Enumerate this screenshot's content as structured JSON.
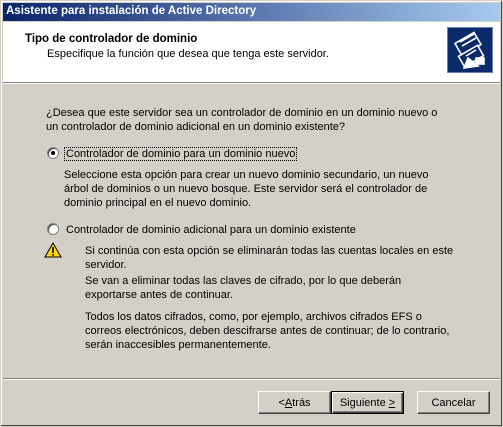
{
  "window": {
    "title": "Asistente para instalación de Active Directory"
  },
  "header": {
    "title": "Tipo de controlador de dominio",
    "subtitle": "Especifique la función que desea que tenga este servidor.",
    "icon": "active-directory-wizard-icon"
  },
  "main": {
    "question": "¿Desea que este servidor sea un controlador de dominio en un dominio nuevo o un controlador de dominio adicional en un dominio existente?",
    "options": [
      {
        "label": "Controlador de dominio para un dominio nuevo",
        "selected": true,
        "description": "Seleccione esta opción para crear un nuevo dominio secundario, un nuevo árbol de dominios o un nuevo bosque. Este servidor será el controlador de dominio principal en el nuevo dominio."
      },
      {
        "label": "Controlador de dominio adicional para un dominio existente",
        "selected": false
      }
    ],
    "warning": {
      "icon": "warning-icon",
      "line1": "Si continúa con esta opción se eliminarán todas las cuentas locales en este servidor.",
      "line2": "Se van a eliminar todas las claves de cifrado, por lo que deberán exportarse antes de continuar.",
      "line3": "Todos los datos cifrados, como, por ejemplo, archivos cifrados EFS o correos electrónicos, deben descifrarse antes de continuar; de lo contrario, serán inaccesibles permanentemente."
    }
  },
  "footer": {
    "back": {
      "pre": "< ",
      "hot": "A",
      "post": "trás"
    },
    "next": {
      "pre": "Siguiente ",
      "hot": ">",
      "post": ""
    },
    "cancel": "Cancelar"
  },
  "colors": {
    "titlebar_start": "#0a246a",
    "titlebar_end": "#a6caf0",
    "face": "#d4d0c8",
    "icon_bg": "#0a2a6a",
    "warning_yellow": "#ffd800"
  }
}
